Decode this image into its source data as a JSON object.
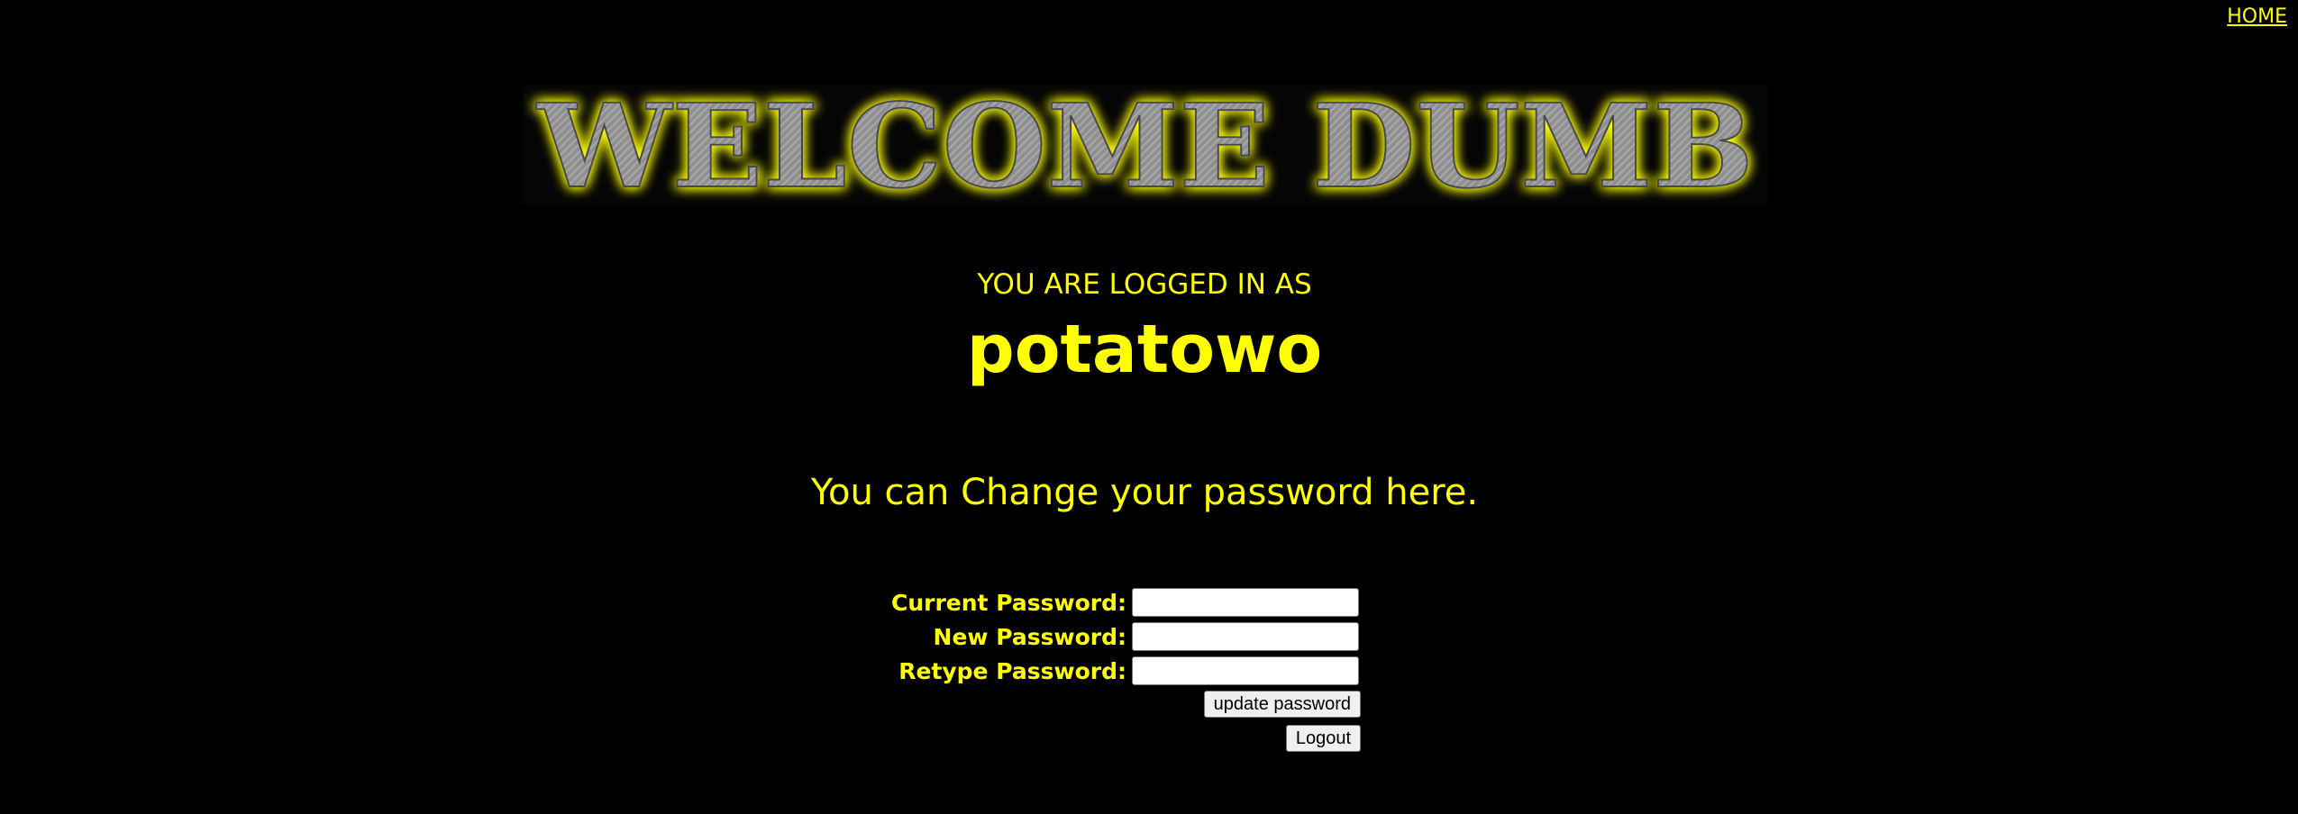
{
  "nav": {
    "home_label": "HOME"
  },
  "banner": {
    "title": "WELCOME DUMB"
  },
  "session": {
    "logged_in_label": "YOU ARE LOGGED IN AS",
    "username": "potatowo"
  },
  "change_message": "You can Change your password here.",
  "form": {
    "current_label": "Current Password:",
    "current_value": "",
    "new_label": "New Password:",
    "new_value": "",
    "retype_label": "Retype Password:",
    "retype_value": "",
    "update_button": "update password",
    "logout_button": "Logout"
  },
  "colors": {
    "background": "#000000",
    "accent": "#ffff00",
    "banner_text": "#9a9a9a"
  }
}
